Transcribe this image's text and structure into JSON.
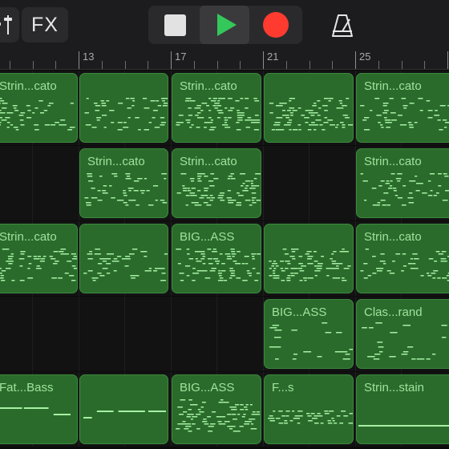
{
  "toolbar": {
    "fx_label": "FX"
  },
  "ruler": {
    "bar_numbers": [
      "13",
      "17",
      "21",
      "25"
    ]
  },
  "tracks": [
    {
      "regions": [
        {
          "name": "Strin...cato",
          "pattern": "stacc"
        },
        {
          "name": "",
          "pattern": "stacc"
        },
        {
          "name": "Strin...cato",
          "pattern": "dense"
        },
        {
          "name": "",
          "pattern": "dense"
        },
        {
          "name": "Strin...cato",
          "pattern": "stacc"
        }
      ]
    },
    {
      "regions": [
        {
          "name": "Strin...cato",
          "pattern": "stacc"
        },
        {
          "name": "Strin...cato",
          "pattern": "dense"
        },
        {
          "name": "Strin...cato",
          "pattern": "stacc"
        }
      ]
    },
    {
      "regions": [
        {
          "name": "Strin...cato",
          "pattern": "stacc"
        },
        {
          "name": "",
          "pattern": "stacc"
        },
        {
          "name": "BIG...ASS",
          "pattern": "dense"
        },
        {
          "name": "",
          "pattern": "dense"
        },
        {
          "name": "Strin...cato",
          "pattern": "stacc"
        }
      ]
    },
    {
      "regions": [
        {
          "name": "BIG...ASS",
          "pattern": "sparse"
        },
        {
          "name": "Clas...rand",
          "pattern": "sparse"
        }
      ]
    },
    {
      "regions": [
        {
          "name": "Fat...Bass",
          "pattern": "bass"
        },
        {
          "name": "",
          "pattern": "bass"
        },
        {
          "name": "BIG...ASS",
          "pattern": "dense"
        },
        {
          "name": "F...s",
          "pattern": "lowdense"
        },
        {
          "name": "Strin...stain",
          "pattern": "sustain"
        }
      ]
    }
  ],
  "colors": {
    "region_fill": "#2a6b2b",
    "region_border": "#3b8a3c",
    "region_label": "#9fe39e",
    "note": "#a6f0a4",
    "play": "#34c759",
    "record": "#ff3b30"
  }
}
